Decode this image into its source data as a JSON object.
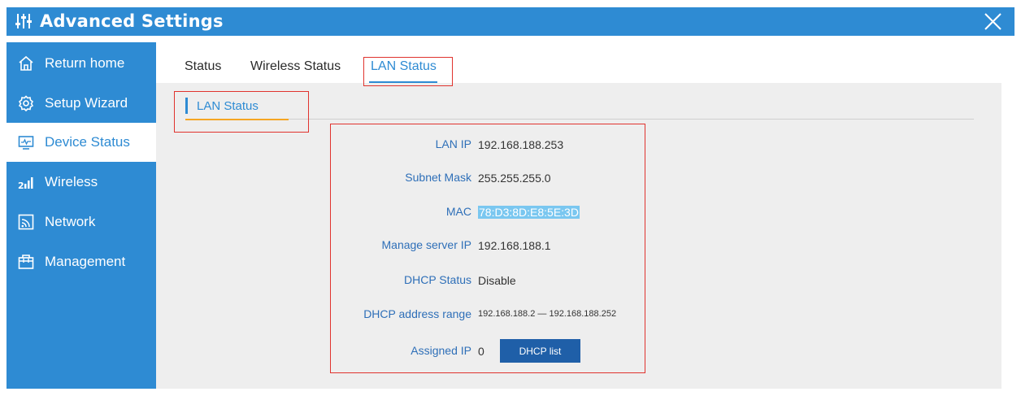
{
  "window": {
    "title": "Advanced Settings",
    "title_icon": "sliders-icon",
    "close_icon": "close-icon"
  },
  "sidebar": {
    "items": [
      {
        "label": "Return home",
        "icon": "home-icon",
        "active": false
      },
      {
        "label": "Setup Wizard",
        "icon": "gear-icon",
        "active": false
      },
      {
        "label": "Device Status",
        "icon": "monitor-icon",
        "active": true
      },
      {
        "label": "Wireless",
        "icon": "signal-icon",
        "active": false
      },
      {
        "label": "Network",
        "icon": "network-icon",
        "active": false
      },
      {
        "label": "Management",
        "icon": "briefcase-icon",
        "active": false
      }
    ]
  },
  "tabs": [
    {
      "label": "Status",
      "active": false
    },
    {
      "label": "Wireless Status",
      "active": false
    },
    {
      "label": "LAN Status",
      "active": true
    }
  ],
  "section": {
    "title": "LAN Status"
  },
  "lan_status": {
    "lan_ip": {
      "label": "LAN IP",
      "value": "192.168.188.253"
    },
    "subnet_mask": {
      "label": "Subnet Mask",
      "value": "255.255.255.0"
    },
    "mac": {
      "label": "MAC",
      "value": "78:D3:8D:E8:5E:3D"
    },
    "manage_server_ip": {
      "label": "Manage server IP",
      "value": "192.168.188.1"
    },
    "dhcp_status": {
      "label": "DHCP Status",
      "value": "Disable"
    },
    "dhcp_range": {
      "label": "DHCP address range",
      "start": "192.168.188.2",
      "separator": "—",
      "end": "192.168.188.252"
    },
    "assigned_ip": {
      "label": "Assigned IP",
      "value": "0"
    },
    "dhcp_list_button": "DHCP list"
  },
  "colors": {
    "accent": "#2e8bd3",
    "label_blue": "#2e6fb8",
    "button_blue": "#1f5fa8",
    "highlight_box": "#e0332e",
    "section_underline": "#f5a623",
    "content_bg": "#eeeeee"
  }
}
